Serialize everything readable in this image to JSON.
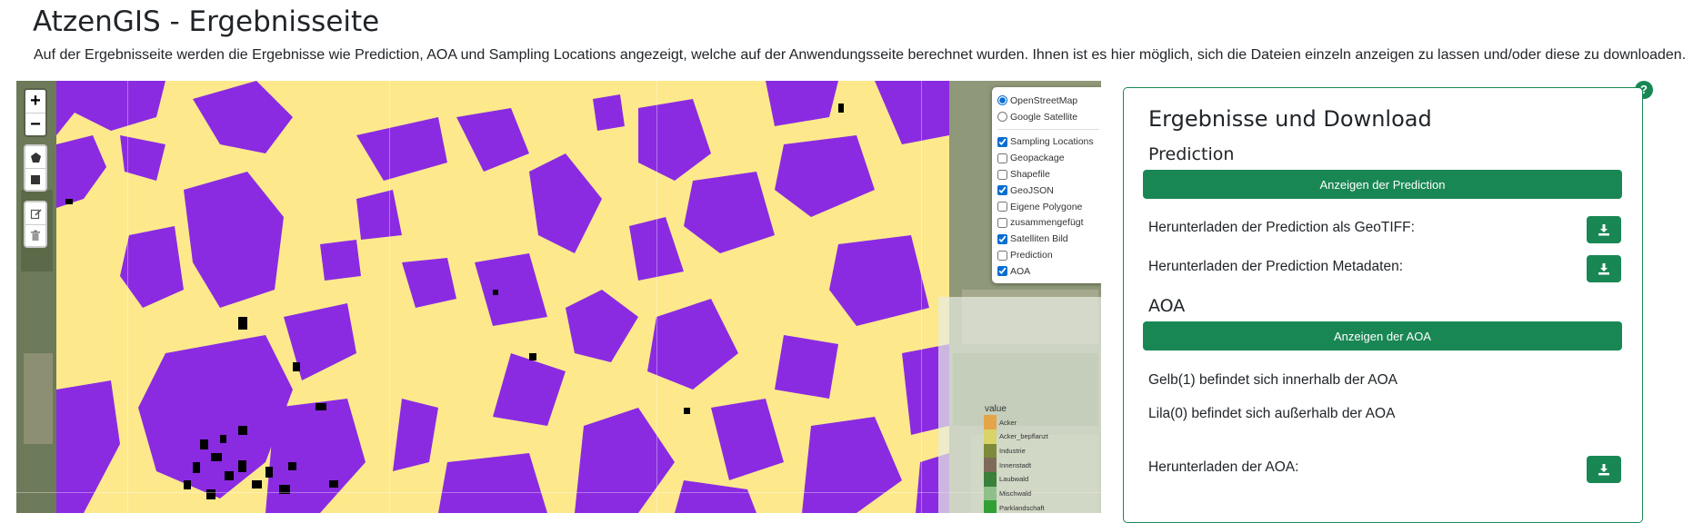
{
  "page": {
    "title": "AtzenGIS - Ergebnisseite",
    "intro": "Auf der Ergebnisseite werden die Ergebnisse wie Prediction, AOA und Sampling Locations angezeigt, welche auf der Anwendungsseite berechnet wurden. Ihnen ist es hier möglich, sich die Dateien einzeln anzeigen zu lassen und/oder diese zu downloaden."
  },
  "map": {
    "zoom_in": "+",
    "zoom_out": "−",
    "base_layers": [
      {
        "label": "OpenStreetMap",
        "checked": true
      },
      {
        "label": "Google Satellite",
        "checked": false
      }
    ],
    "overlays": [
      {
        "label": "Sampling Locations",
        "checked": true
      },
      {
        "label": "Geopackage",
        "checked": false
      },
      {
        "label": "Shapefile",
        "checked": false
      },
      {
        "label": "GeoJSON",
        "checked": true
      },
      {
        "label": "Eigene Polygone",
        "checked": false
      },
      {
        "label": "zusammengefügt",
        "checked": false
      },
      {
        "label": "Satelliten Bild",
        "checked": true
      },
      {
        "label": "Prediction",
        "checked": false
      },
      {
        "label": "AOA",
        "checked": true
      }
    ],
    "legend": {
      "title": "value",
      "entries": [
        {
          "label": "Acker",
          "color": "#e4a54a"
        },
        {
          "label": "Acker_bepflanzt",
          "color": "#d9d36a"
        },
        {
          "label": "Industrie",
          "color": "#7d8a3b"
        },
        {
          "label": "Innenstadt",
          "color": "#7f6a5a"
        },
        {
          "label": "Laubwald",
          "color": "#39803a"
        },
        {
          "label": "Mischwald",
          "color": "#8fc08a"
        },
        {
          "label": "Parklandschaft",
          "color": "#30a034"
        }
      ]
    },
    "colors": {
      "inside_aoa": "#fde98c",
      "outside_aoa": "#8a2be2",
      "sampling": "#000000"
    }
  },
  "panel": {
    "help": "?",
    "title": "Ergebnisse und Download",
    "prediction": {
      "title": "Prediction",
      "show_button": "Anzeigen der Prediction",
      "download_geotiff": "Herunterladen der Prediction als GeoTIFF:",
      "download_meta": "Herunterladen der Prediction Metadaten:"
    },
    "aoa": {
      "title": "AOA",
      "show_button": "Anzeigen der AOA",
      "inside_text": "Gelb(1) befindet sich innerhalb der AOA",
      "outside_text": "Lila(0) befindet sich außerhalb der AOA",
      "download": "Herunterladen der AOA:"
    },
    "download_icon": "download-icon"
  }
}
